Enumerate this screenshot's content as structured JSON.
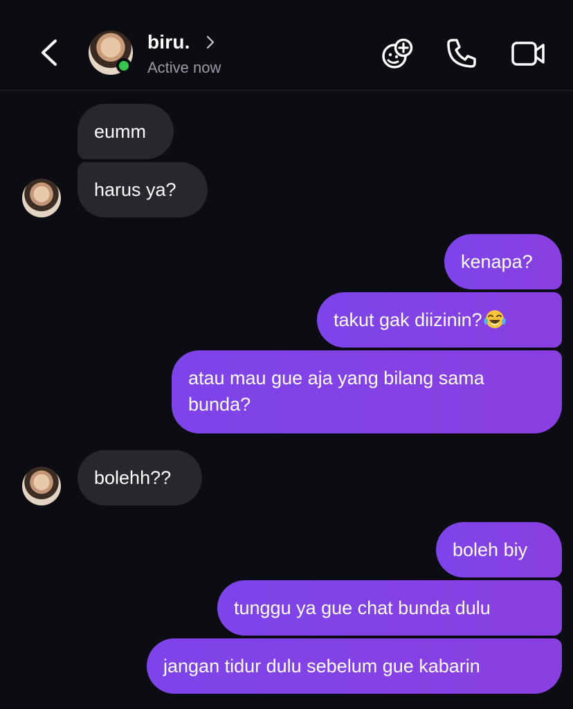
{
  "header": {
    "name": "biru.",
    "status": "Active now",
    "back_icon": "chevron-left-icon",
    "icons": [
      "effects-icon",
      "phone-icon",
      "video-icon"
    ],
    "online_color": "#36c64b"
  },
  "messages": [
    {
      "from": "them",
      "text": "eumm"
    },
    {
      "from": "them",
      "text": "harus ya?"
    },
    {
      "from": "me",
      "text": "kenapa?"
    },
    {
      "from": "me",
      "text": "takut gak diizinin?",
      "emoji": "😂"
    },
    {
      "from": "me",
      "text_line1": "atau mau gue aja yang bilang sama",
      "text_line2": "bunda?"
    },
    {
      "from": "them",
      "text": "bolehh??"
    },
    {
      "from": "me",
      "text": "boleh biy"
    },
    {
      "from": "me",
      "text": "tunggu ya gue chat bunda dulu"
    },
    {
      "from": "me",
      "text": "jangan tidur dulu sebelum gue kabarin"
    }
  ],
  "colors": {
    "background": "#0c0d12",
    "received_bubble": "#26282d",
    "sent_bubble": "#8a3fe0"
  }
}
